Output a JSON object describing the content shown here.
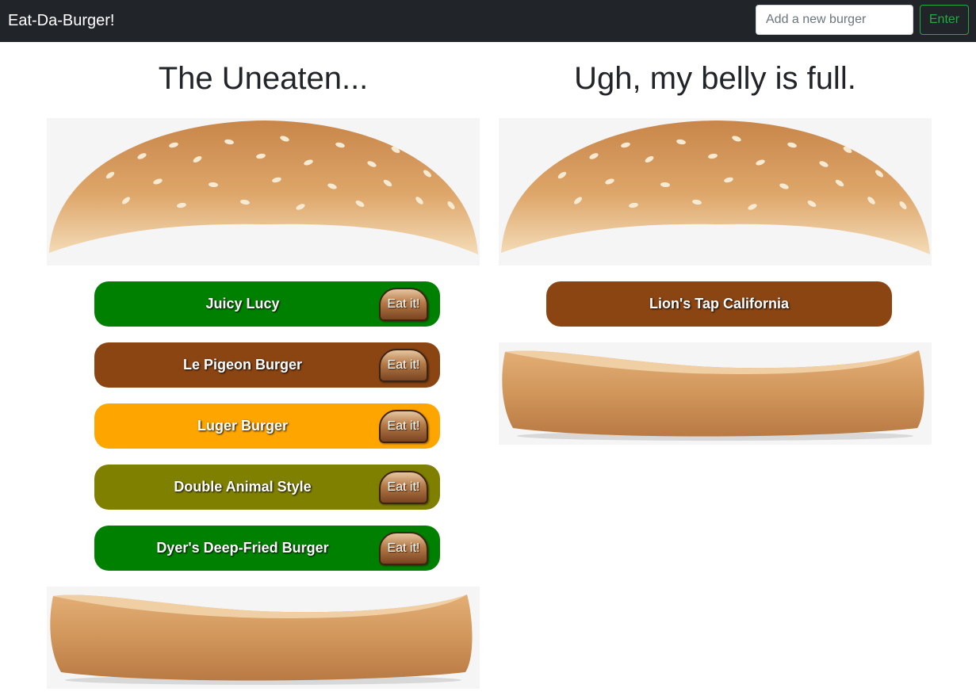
{
  "header": {
    "brand": "Eat-Da-Burger!",
    "input_placeholder": "Add a new burger",
    "input_value": "",
    "enter_label": "Enter"
  },
  "uneaten": {
    "title": "The Uneaten...",
    "eat_label": "Eat it!",
    "items": [
      {
        "name": "Juicy Lucy",
        "color": "#008000"
      },
      {
        "name": "Le Pigeon Burger",
        "color": "#8b4513"
      },
      {
        "name": "Luger Burger",
        "color": "#ffa500"
      },
      {
        "name": "Double Animal Style",
        "color": "#808000"
      },
      {
        "name": "Dyer's Deep-Fried Burger",
        "color": "#008000"
      }
    ]
  },
  "eaten": {
    "title": "Ugh, my belly is full.",
    "items": [
      {
        "name": "Lion's Tap California",
        "color": "#8b4513"
      }
    ]
  },
  "colors": {
    "navbar": "#212529",
    "enter_outline": "#28a745",
    "bun_crust": "#d19a5c",
    "bun_background": "#f5f5f5"
  }
}
